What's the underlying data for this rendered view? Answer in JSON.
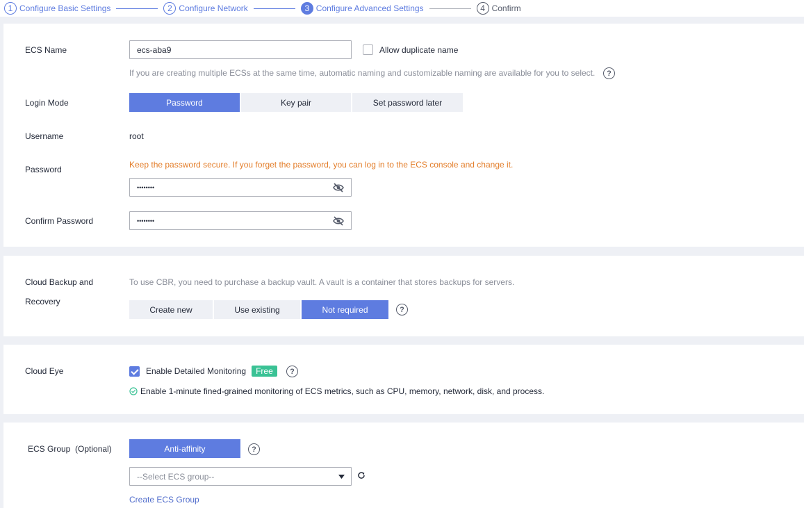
{
  "stepper": {
    "steps": [
      {
        "num": "1",
        "label": "Configure Basic Settings"
      },
      {
        "num": "2",
        "label": "Configure Network"
      },
      {
        "num": "3",
        "label": "Configure Advanced Settings"
      },
      {
        "num": "4",
        "label": "Confirm"
      }
    ]
  },
  "basic": {
    "ecs_name_label": "ECS Name",
    "ecs_name_value": "ecs-aba9",
    "allow_duplicate_label": "Allow duplicate name",
    "naming_hint": "If you are creating multiple ECSs at the same time, automatic naming and customizable naming are available for you to select.",
    "login_mode_label": "Login Mode",
    "login_modes": [
      "Password",
      "Key pair",
      "Set password later"
    ],
    "login_mode_selected": "Password",
    "username_label": "Username",
    "username_value": "root",
    "password_label": "Password",
    "password_warning": "Keep the password secure. If you forget the password, you can log in to the ECS console and change it.",
    "password_value": "••••••••",
    "confirm_password_label": "Confirm Password",
    "confirm_password_value": "••••••••"
  },
  "backup": {
    "label_line1": "Cloud Backup and",
    "label_line2": "Recovery",
    "hint": "To use CBR, you need to purchase a backup vault. A vault is a container that stores backups for servers.",
    "options": [
      "Create new",
      "Use existing",
      "Not required"
    ],
    "selected": "Not required"
  },
  "cloud_eye": {
    "label": "Cloud Eye",
    "checkbox_label": "Enable Detailed Monitoring",
    "checked": true,
    "badge": "Free",
    "description": "Enable 1-minute fined-grained monitoring of ECS metrics, such as CPU, memory, network, disk, and process."
  },
  "ecs_group": {
    "label": "ECS Group  (Optional)",
    "policy_button": "Anti-affinity",
    "select_placeholder": "--Select ECS group--",
    "create_link": "Create ECS Group"
  },
  "colors": {
    "accent": "#5e7ce0",
    "warning": "#e37d29",
    "success": "#3ac295",
    "link": "#526ecc"
  },
  "icons": {
    "help": "question-circle-icon",
    "password_visibility": "eye-slash-icon",
    "refresh": "refresh-icon",
    "dropdown": "caret-down-icon",
    "success": "check-circle-icon"
  }
}
